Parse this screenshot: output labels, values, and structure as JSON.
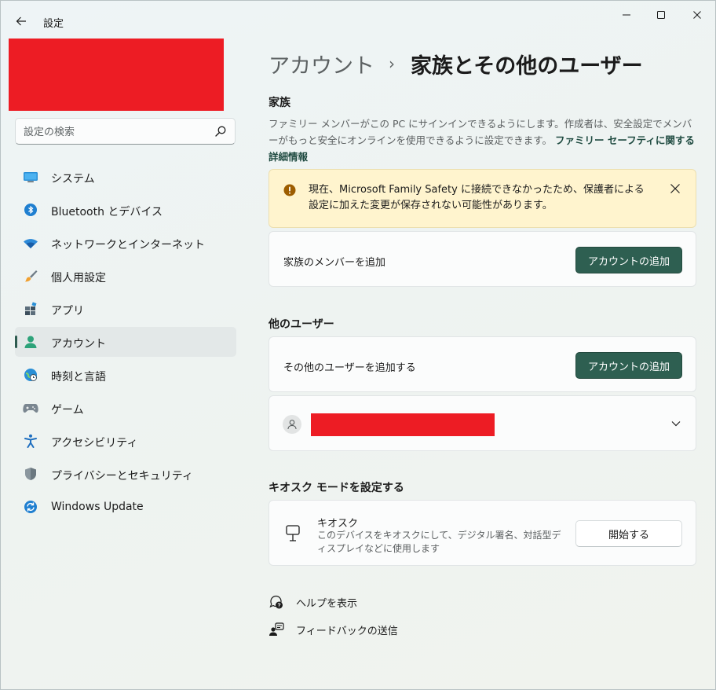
{
  "window": {
    "app_title": "設定"
  },
  "search": {
    "placeholder": "設定の検索"
  },
  "sidebar": {
    "items": [
      {
        "label": "システム",
        "icon": "system-icon"
      },
      {
        "label": "Bluetooth とデバイス",
        "icon": "bluetooth-icon"
      },
      {
        "label": "ネットワークとインターネット",
        "icon": "wifi-icon"
      },
      {
        "label": "個人用設定",
        "icon": "brush-icon"
      },
      {
        "label": "アプリ",
        "icon": "apps-icon"
      },
      {
        "label": "アカウント",
        "icon": "account-icon",
        "selected": true
      },
      {
        "label": "時刻と言語",
        "icon": "time-language-icon"
      },
      {
        "label": "ゲーム",
        "icon": "gamepad-icon"
      },
      {
        "label": "アクセシビリティ",
        "icon": "accessibility-icon"
      },
      {
        "label": "プライバシーとセキュリティ",
        "icon": "shield-icon"
      },
      {
        "label": "Windows Update",
        "icon": "update-icon"
      }
    ]
  },
  "breadcrumb": {
    "parent": "アカウント",
    "separator": "›",
    "current": "家族とその他のユーザー"
  },
  "family": {
    "title": "家族",
    "description": "ファミリー メンバーがこの PC にサインインできるようにします。作成者は、安全設定でメンバーがもっと安全にオンラインを使用できるように設定できます。",
    "link": "ファミリー セーフティに関する詳細情報",
    "warning_line1": "現在、Microsoft Family Safety に接続できなかったため、保護者による",
    "warning_line2": "設定に加えた変更が保存されない可能性があります。",
    "add_member_label": "家族のメンバーを追加",
    "add_account_button": "アカウントの追加"
  },
  "other_users": {
    "title": "他のユーザー",
    "add_label": "その他のユーザーを追加する",
    "add_account_button": "アカウントの追加"
  },
  "kiosk": {
    "title": "キオスク モードを設定する",
    "item_title": "キオスク",
    "item_desc": "このデバイスをキオスクにして、デジタル署名、対話型ディスプレイなどに使用します",
    "start_button": "開始する"
  },
  "help": {
    "show_help": "ヘルプを表示",
    "feedback": "フィードバックの送信"
  },
  "colors": {
    "accent": "#2e5f51",
    "warning_bg": "#fff4ce",
    "warning_icon": "#9d5d00",
    "redaction": "#ed1c24"
  }
}
